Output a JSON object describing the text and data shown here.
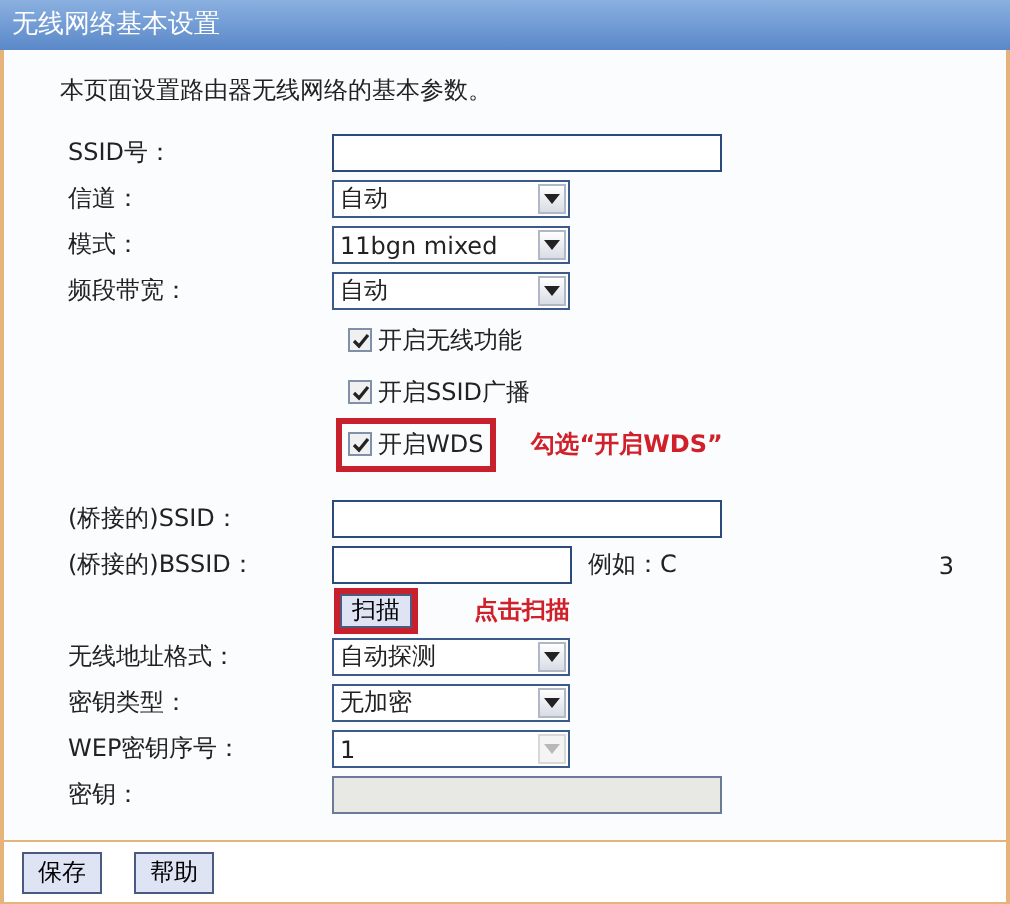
{
  "window": {
    "title": "无线网络基本设置"
  },
  "description": "本页面设置路由器无线网络的基本参数。",
  "rows": [
    {
      "kind": "text",
      "label": "SSID号：",
      "wide": true,
      "disabled": false
    },
    {
      "kind": "select",
      "label": "信道：",
      "value": "自动",
      "disabled": false
    },
    {
      "kind": "select",
      "label": "模式：",
      "value": "11bgn mixed",
      "disabled": false
    },
    {
      "kind": "select",
      "label": "频段带宽：",
      "value": "自动",
      "disabled": false
    },
    {
      "kind": "checkbox",
      "text": "开启无线功能",
      "checked": true,
      "highlighted": false
    },
    {
      "kind": "checkbox",
      "text": "开启SSID广播",
      "checked": true,
      "highlighted": false
    },
    {
      "kind": "checkbox",
      "text": "开启WDS",
      "checked": true,
      "highlighted": true,
      "note": "勾选“开启WDS”"
    },
    {
      "kind": "spacer"
    },
    {
      "kind": "text",
      "label": "(桥接的)SSID：",
      "wide": true,
      "disabled": false
    },
    {
      "kind": "text",
      "label": "(桥接的)BSSID：",
      "wide": false,
      "disabled": false,
      "hint_start": "例如：C",
      "hint_end": "3"
    },
    {
      "kind": "button",
      "text": "扫描",
      "highlighted": true,
      "note": "点击扫描"
    },
    {
      "kind": "select",
      "label": "无线地址格式：",
      "value": "自动探测",
      "disabled": false
    },
    {
      "kind": "select",
      "label": "密钥类型：",
      "value": "无加密",
      "disabled": false
    },
    {
      "kind": "select",
      "label": "WEP密钥序号：",
      "value": "1",
      "disabled": true
    },
    {
      "kind": "text",
      "label": "密钥：",
      "wide": true,
      "disabled": true
    }
  ],
  "buttons": [
    "保存",
    "帮助"
  ]
}
